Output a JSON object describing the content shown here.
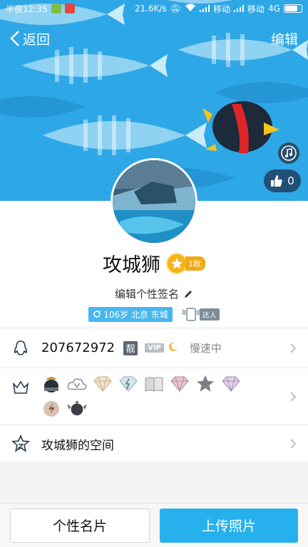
{
  "status_bar": {
    "time": "半夜12:35",
    "net_speed": "21.6K/s",
    "carrier1": "移动",
    "carrier2": "移动",
    "net_type": "4G"
  },
  "nav": {
    "back_label": "返回",
    "edit_label": "编辑"
  },
  "cover": {
    "like_count": "0"
  },
  "profile": {
    "nickname": "攻城狮",
    "medal_count": "1枚",
    "signature": "编辑个性签名",
    "info_tag": "106岁 北京 东城",
    "master_label": "达人"
  },
  "qq_row": {
    "number": "207672972",
    "liang_badge": "靓",
    "vip_badge": "VIP",
    "status": "慢速中"
  },
  "space_row": {
    "label": "攻城狮的空间"
  },
  "bottom": {
    "card_label": "个性名片",
    "upload_label": "上传照片"
  },
  "colors": {
    "accent": "#26b1ee",
    "cover_bg": "#2aa4e4",
    "medal": "#f7b418"
  }
}
